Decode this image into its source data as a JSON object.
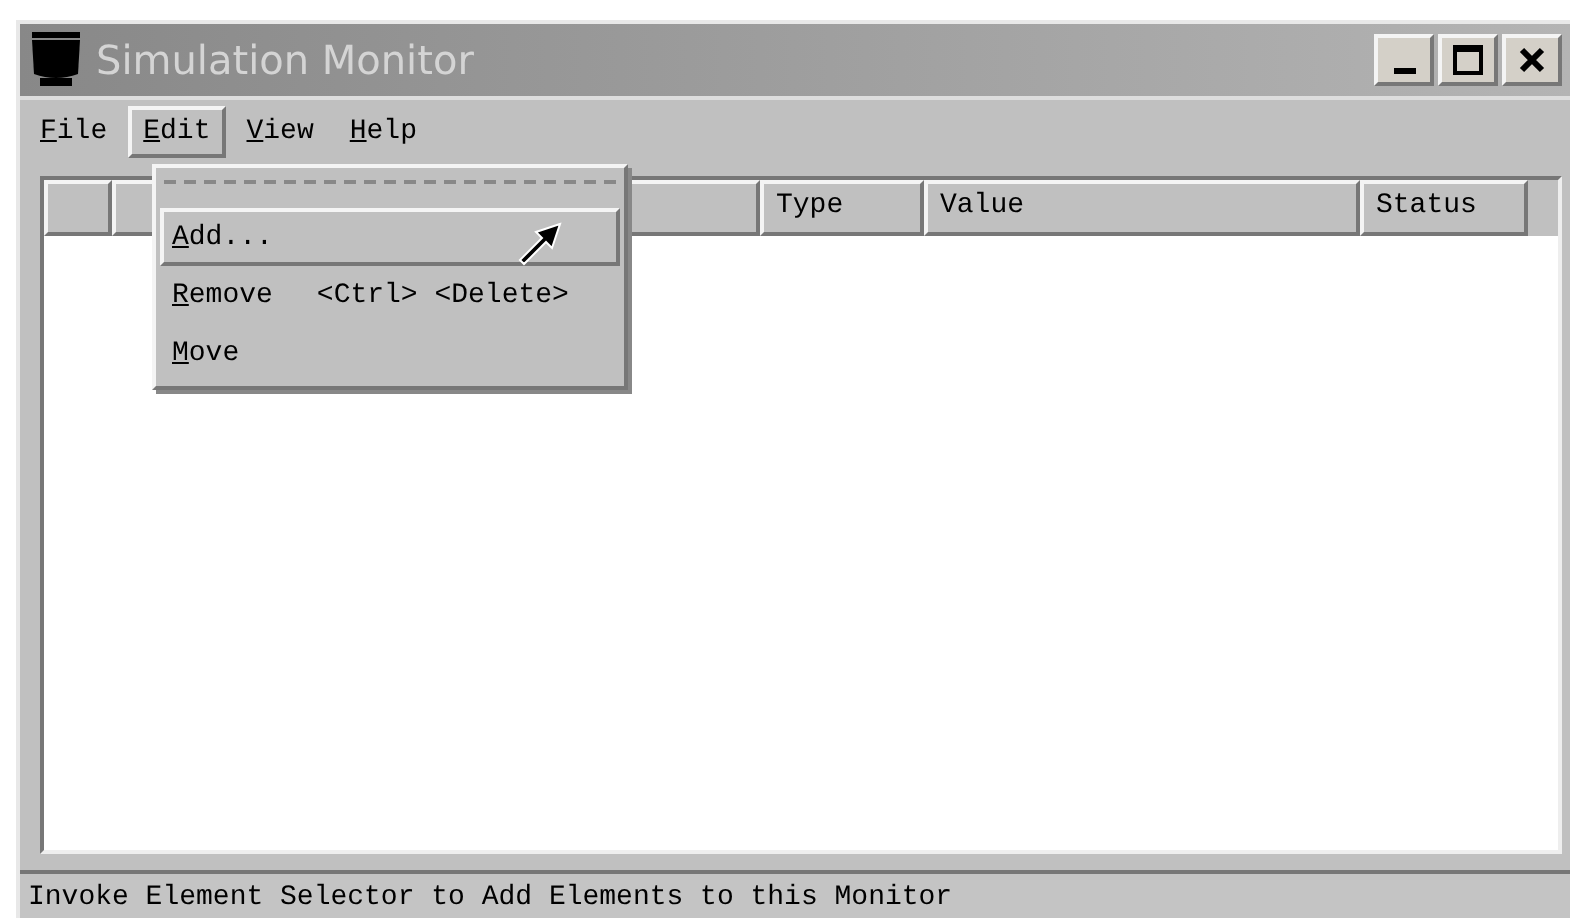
{
  "window": {
    "title": "Simulation Monitor",
    "controls": [
      {
        "kind": "minimize"
      },
      {
        "kind": "maximize"
      },
      {
        "kind": "close"
      }
    ]
  },
  "menu_bar": [
    {
      "label": "File",
      "selected": false
    },
    {
      "label": "Edit",
      "selected": true
    },
    {
      "label": "View",
      "selected": false
    },
    {
      "label": "Help",
      "selected": false
    }
  ],
  "dropdown": {
    "items": [
      {
        "label": "Add...",
        "selected": true
      },
      {
        "label": "Remove",
        "shortcut": "<Ctrl> <Delete>",
        "selected": false
      },
      {
        "label": "Move",
        "selected": false
      }
    ]
  },
  "table": {
    "columns": [
      "Type",
      "Value",
      "Status"
    ]
  },
  "status_bar": "Invoke Element Selector to Add Elements to this Monitor"
}
